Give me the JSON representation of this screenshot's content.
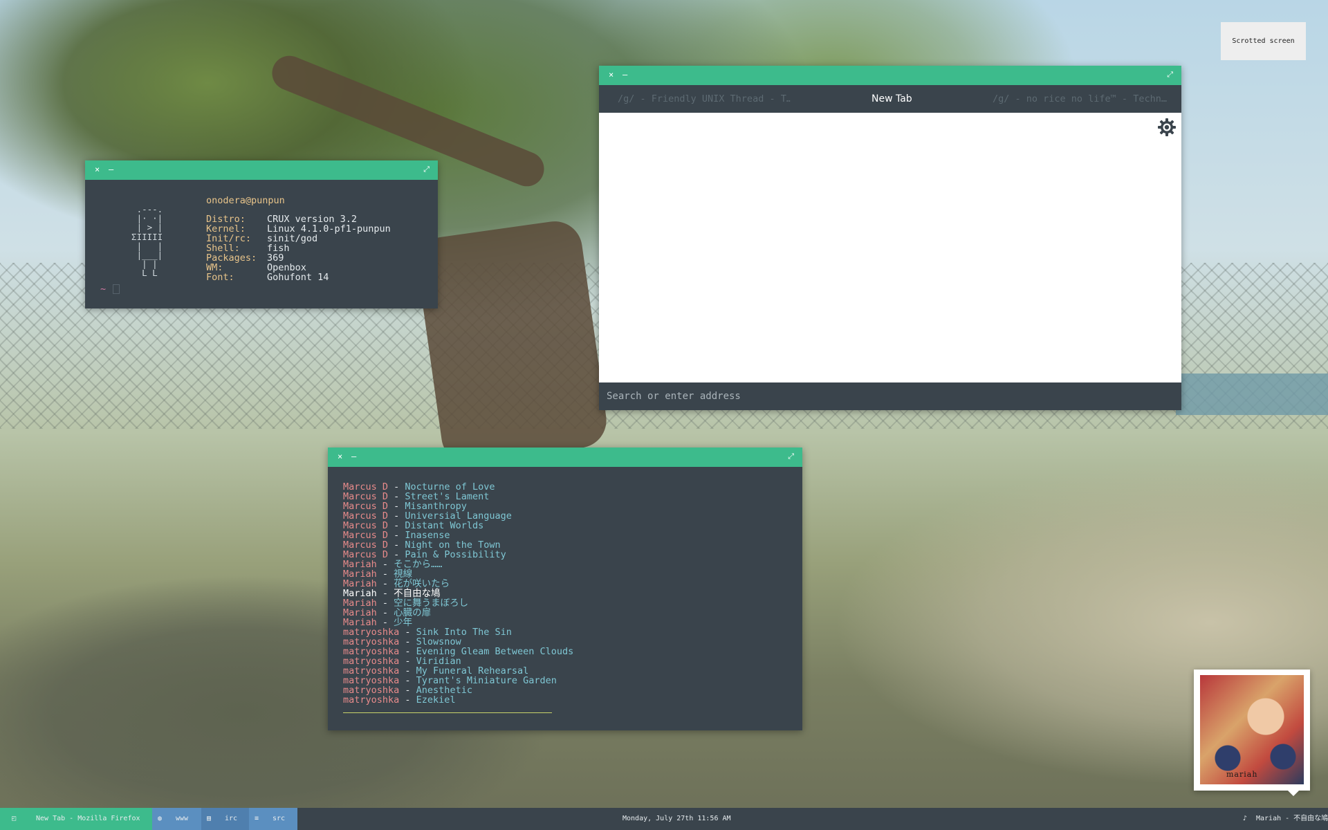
{
  "notification": {
    "text": "Scrotted screen"
  },
  "terminal_info": {
    "userhost": "onodera@punpun",
    "ascii_art": "   .---.\n   |· ·|\n   | > |\n  ΣIIIII\n   |   |\n   |___|\n    | |\n    L L",
    "rows": [
      {
        "key": "Distro:",
        "value": "CRUX version 3.2"
      },
      {
        "key": "Kernel:",
        "value": "Linux 4.1.0-pf1-punpun"
      },
      {
        "key": "Init/rc:",
        "value": "sinit/god"
      },
      {
        "key": "Shell:",
        "value": "fish"
      },
      {
        "key": "Packages:",
        "value": "369"
      },
      {
        "key": "WM:",
        "value": "Openbox"
      },
      {
        "key": "Font:",
        "value": "Gohufont 14"
      }
    ],
    "prompt": "~"
  },
  "browser": {
    "tabs": [
      {
        "label": "/g/ - Friendly UNIX Thread - T…",
        "active": false
      },
      {
        "label": "New Tab",
        "active": true
      },
      {
        "label": "/g/ - no rice no life™ - Techn…",
        "active": false
      }
    ],
    "address_placeholder": "Search or enter address",
    "settings_icon": "gear-icon"
  },
  "music": {
    "separator": " - ",
    "tracks": [
      {
        "artist": "Marcus D",
        "title": "Nocturne of Love"
      },
      {
        "artist": "Marcus D",
        "title": "Street's Lament"
      },
      {
        "artist": "Marcus D",
        "title": "Misanthropy"
      },
      {
        "artist": "Marcus D",
        "title": "Universial Language"
      },
      {
        "artist": "Marcus D",
        "title": "Distant Worlds"
      },
      {
        "artist": "Marcus D",
        "title": "Inasense"
      },
      {
        "artist": "Marcus D",
        "title": "Night on the Town"
      },
      {
        "artist": "Marcus D",
        "title": "Pain & Possibility"
      },
      {
        "artist": "Mariah",
        "title": "そこから……"
      },
      {
        "artist": "Mariah",
        "title": "視線"
      },
      {
        "artist": "Mariah",
        "title": "花が咲いたら"
      },
      {
        "artist": "Mariah",
        "title": "不自由な鳩",
        "current": true
      },
      {
        "artist": "Mariah",
        "title": "空に舞うまぼろし"
      },
      {
        "artist": "Mariah",
        "title": "心臓の扉"
      },
      {
        "artist": "Mariah",
        "title": "少年"
      },
      {
        "artist": "matryoshka",
        "title": "Sink Into The Sin"
      },
      {
        "artist": "matryoshka",
        "title": "Slowsnow"
      },
      {
        "artist": "matryoshka",
        "title": "Evening Gleam Between Clouds"
      },
      {
        "artist": "matryoshka",
        "title": "Viridian"
      },
      {
        "artist": "matryoshka",
        "title": "My Funeral Rehearsal"
      },
      {
        "artist": "matryoshka",
        "title": "Tyrant's Miniature Garden"
      },
      {
        "artist": "matryoshka",
        "title": "Anesthetic"
      },
      {
        "artist": "matryoshka",
        "title": "Ezekiel"
      }
    ],
    "progress_fraction": 0.47
  },
  "album": {
    "art_text": "mariah"
  },
  "taskbar": {
    "active_window": "New Tab - Mozilla Firefox",
    "workspaces": [
      {
        "label": "www",
        "icon": "globe-icon"
      },
      {
        "label": "irc",
        "icon": "chat-icon"
      },
      {
        "label": "src",
        "icon": "code-icon"
      }
    ],
    "clock": "Monday, July 27th 11:56 AM",
    "now_playing": "Mariah - 不自由な鳩"
  },
  "colors": {
    "accent": "#3dbb8c",
    "window_bg": "#3a444c",
    "label_yellow": "#e8c48a",
    "artist_red": "#e88b8b",
    "song_cyan": "#7fc7d4",
    "workspace_blue": "#5b8fc0"
  }
}
